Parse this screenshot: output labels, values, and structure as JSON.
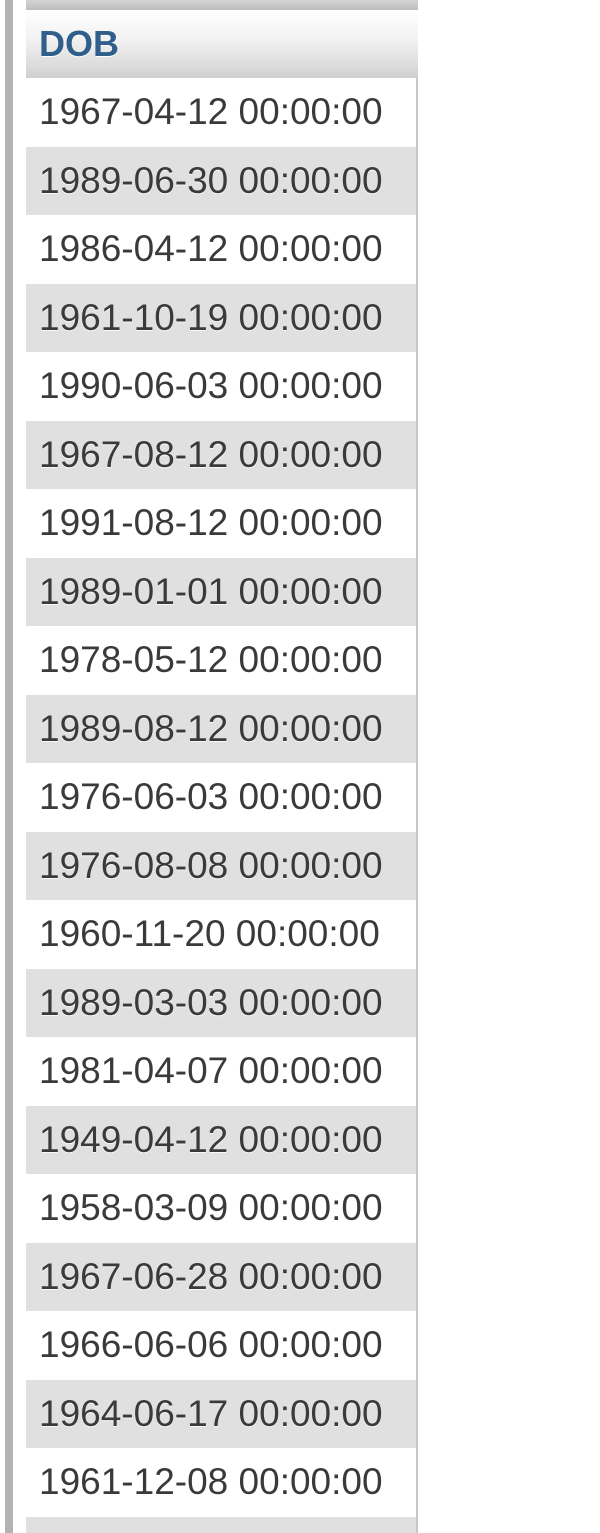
{
  "table": {
    "column_header": "DOB",
    "rows": [
      "1967-04-12 00:00:00",
      "1989-06-30 00:00:00",
      "1986-04-12 00:00:00",
      "1961-10-19 00:00:00",
      "1990-06-03 00:00:00",
      "1967-08-12 00:00:00",
      "1991-08-12 00:00:00",
      "1989-01-01 00:00:00",
      "1978-05-12 00:00:00",
      "1989-08-12 00:00:00",
      "1976-06-03 00:00:00",
      "1976-08-08 00:00:00",
      "1960-11-20 00:00:00",
      "1989-03-03 00:00:00",
      "1981-04-07 00:00:00",
      "1949-04-12 00:00:00",
      "1958-03-09 00:00:00",
      "1967-06-28 00:00:00",
      "1966-06-06 00:00:00",
      "1964-06-17 00:00:00",
      "1961-12-08 00:00:00",
      ""
    ]
  },
  "colors": {
    "header_text": "#2f5f8a",
    "row_alt": "#e0e0e0",
    "row_text": "#3a3a3a"
  }
}
